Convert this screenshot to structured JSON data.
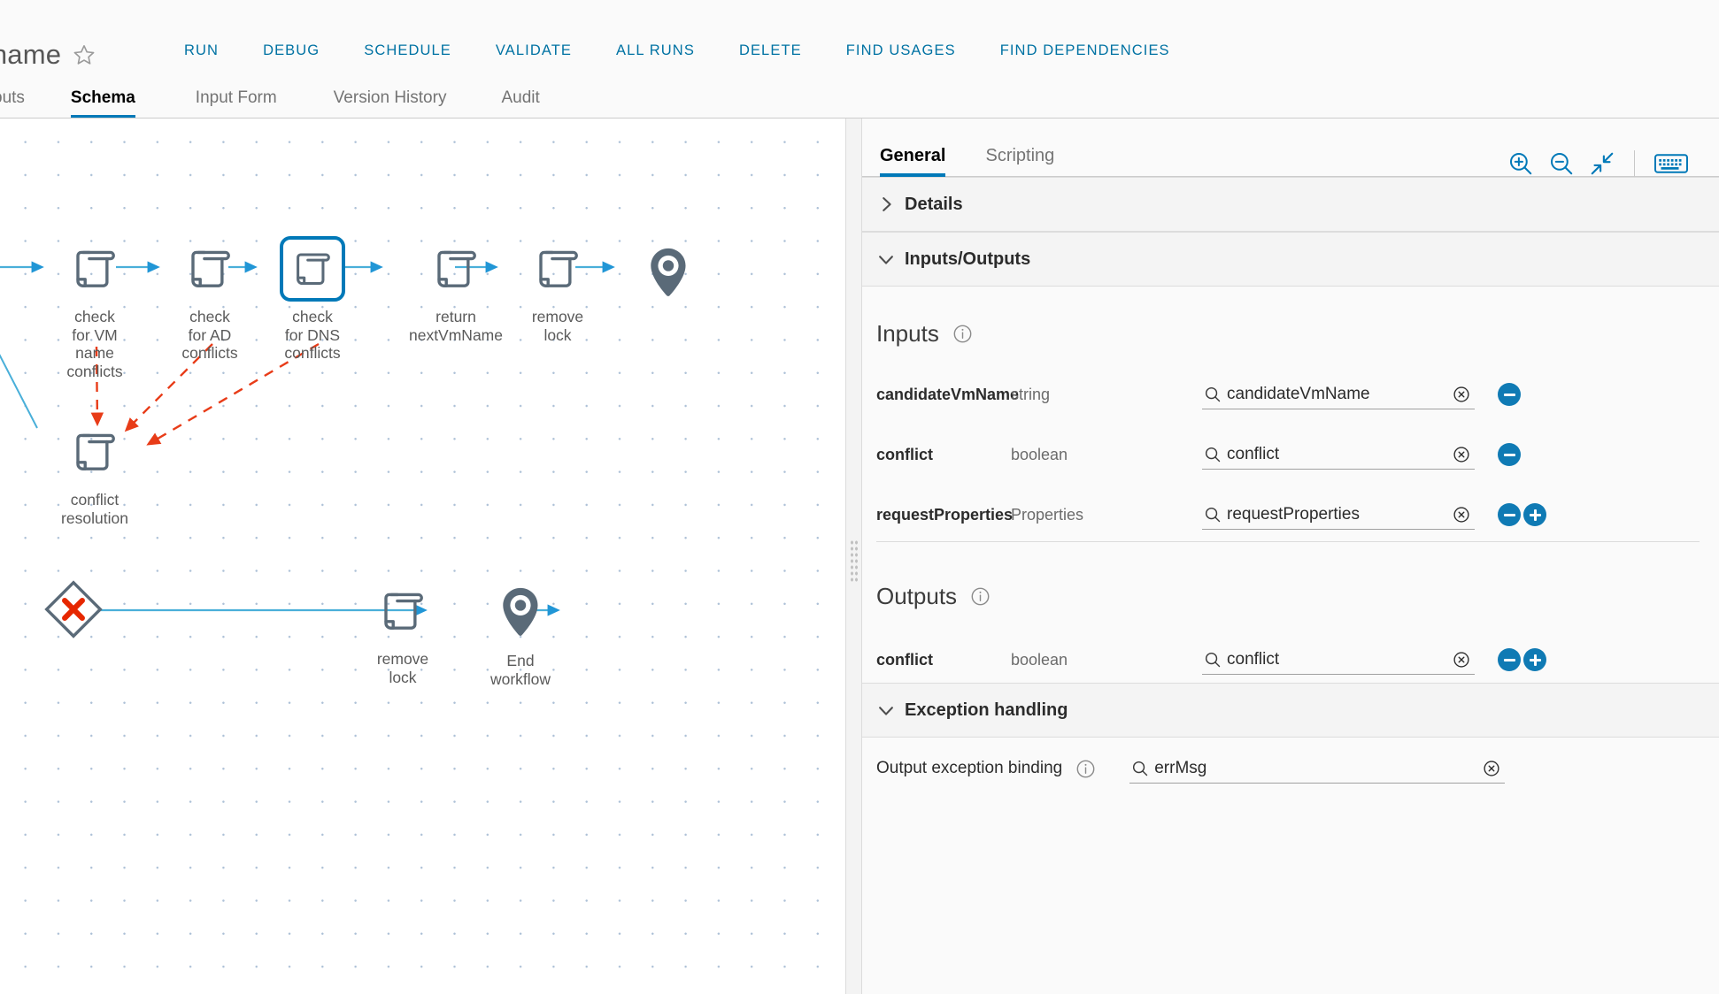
{
  "header": {
    "workflow_title": "tname",
    "favorite_icon": "star-icon",
    "actions": [
      {
        "label": "RUN",
        "name": "run-button"
      },
      {
        "label": "DEBUG",
        "name": "debug-button"
      },
      {
        "label": "SCHEDULE",
        "name": "schedule-button"
      },
      {
        "label": "VALIDATE",
        "name": "validate-button"
      },
      {
        "label": "ALL RUNS",
        "name": "all-runs-button"
      },
      {
        "label": "DELETE",
        "name": "delete-button"
      },
      {
        "label": "FIND USAGES",
        "name": "find-usages-button"
      },
      {
        "label": "FIND DEPENDENCIES",
        "name": "find-dependencies-button"
      }
    ]
  },
  "tabs": [
    {
      "label": "puts",
      "active": false
    },
    {
      "label": "Schema",
      "active": true
    },
    {
      "label": "Input Form",
      "active": false
    },
    {
      "label": "Version History",
      "active": false
    },
    {
      "label": "Audit",
      "active": false
    }
  ],
  "canvas": {
    "toolbar": [
      {
        "name": "zoom-in-icon",
        "label": "Zoom in"
      },
      {
        "name": "zoom-out-icon",
        "label": "Zoom out"
      },
      {
        "name": "fit-to-screen-icon",
        "label": "Fit to screen"
      },
      {
        "name": "keyboard-icon",
        "label": "Keyboard shortcuts"
      }
    ],
    "nodes": [
      {
        "id": "check-vm-name",
        "label": "check\nfor VM\nname\nconflicts",
        "type": "scriptable-task",
        "selected": false
      },
      {
        "id": "check-ad",
        "label": "check\nfor AD\nconflicts",
        "type": "scriptable-task",
        "selected": false
      },
      {
        "id": "check-dns",
        "label": "check\nfor DNS\nconflicts",
        "type": "scriptable-task",
        "selected": true
      },
      {
        "id": "return-next-vm-name",
        "label": "return\nnextVmName",
        "type": "scriptable-task",
        "selected": false
      },
      {
        "id": "remove-lock-top",
        "label": "remove\nlock",
        "type": "scriptable-task",
        "selected": false
      },
      {
        "id": "end-top",
        "label": "",
        "type": "end-marker",
        "selected": false
      },
      {
        "id": "conflict-resolution",
        "label": "conflict\nresolution",
        "type": "scriptable-task",
        "selected": false
      },
      {
        "id": "exception-handler",
        "label": "",
        "type": "error-node",
        "selected": false
      },
      {
        "id": "remove-lock-bottom",
        "label": "remove\nlock",
        "type": "scriptable-task",
        "selected": false
      },
      {
        "id": "end-workflow",
        "label": "End\nworkflow",
        "type": "end-marker",
        "selected": false
      }
    ]
  },
  "detail": {
    "tabs": [
      {
        "label": "General",
        "active": true
      },
      {
        "label": "Scripting",
        "active": false
      }
    ],
    "sections": {
      "details": {
        "title": "Details",
        "expanded": false,
        "chevron": "chevron-right-icon"
      },
      "inputs_outputs": {
        "title": "Inputs/Outputs",
        "expanded": true,
        "chevron": "chevron-down-icon"
      },
      "exception_handling": {
        "title": "Exception handling",
        "expanded": true,
        "chevron": "chevron-down-icon"
      }
    },
    "inputs": {
      "heading": "Inputs",
      "rows": [
        {
          "name": "candidateVmName",
          "type": "string",
          "binding": "candidateVmName",
          "has_add": false
        },
        {
          "name": "conflict",
          "type": "boolean",
          "binding": "conflict",
          "has_add": false
        },
        {
          "name": "requestProperties",
          "type": "Properties",
          "binding": "requestProperties",
          "has_add": true
        }
      ]
    },
    "outputs": {
      "heading": "Outputs",
      "rows": [
        {
          "name": "conflict",
          "type": "boolean",
          "binding": "conflict",
          "has_add": true
        }
      ]
    },
    "exception": {
      "label": "Output exception binding",
      "binding": "errMsg"
    }
  },
  "colors": {
    "accent_blue": "#0079b8",
    "link_blue": "#0072a3",
    "button_blue": "#0f7ab4",
    "node_gray": "#5a6a78",
    "error_red": "#e62700",
    "flow_blue": "#49afd9"
  }
}
